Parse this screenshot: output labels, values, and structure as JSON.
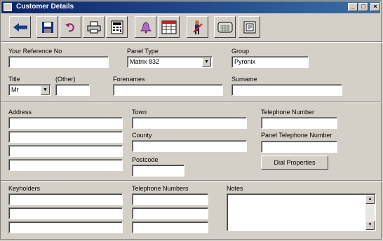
{
  "window": {
    "title": "Customer Details"
  },
  "toolbar": {
    "buttons": [
      "back-arrow-icon",
      "save-disk-icon",
      "undo-icon",
      "printer-icon",
      "calculator-icon",
      "bell-icon",
      "spreadsheet-icon",
      "person-icon",
      "keypad-icon",
      "document-icon"
    ]
  },
  "fields": {
    "your_reference_label": "Your Reference No",
    "your_reference_value": "",
    "panel_type_label": "Panel Type",
    "panel_type_value": "Matrix 832",
    "group_label": "Group",
    "group_value": "Pyronix",
    "title_label": "Title",
    "title_value": "Mr",
    "other_label": "(Other)",
    "other_value": "",
    "forenames_label": "Forenames",
    "forenames_value": "",
    "surname_label": "Surname",
    "surname_value": "",
    "address_label": "Address",
    "town_label": "Town",
    "county_label": "County",
    "postcode_label": "Postcode",
    "telephone_label": "Telephone Number",
    "panel_telephone_label": "Panel Telephone Number",
    "dial_properties_button": "Dial Properties",
    "keyholders_label": "Keyholders",
    "telephone_numbers_label": "Telephone Numbers",
    "notes_label": "Notes"
  }
}
